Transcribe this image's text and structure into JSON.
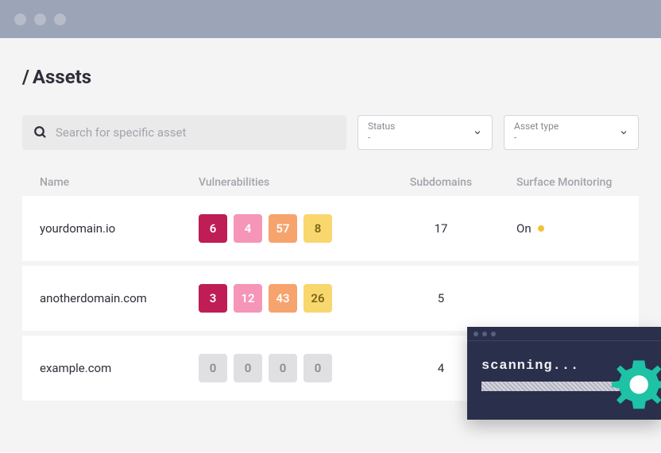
{
  "page": {
    "title_slash": "/",
    "title_text": "Assets"
  },
  "search": {
    "placeholder": "Search for specific asset"
  },
  "filters": {
    "status": {
      "label": "Status",
      "value": "-"
    },
    "asset_type": {
      "label": "Asset type",
      "value": "-"
    }
  },
  "columns": {
    "name": "Name",
    "vulnerabilities": "Vulnerabilities",
    "subdomains": "Subdomains",
    "surface": "Surface Monitoring"
  },
  "rows": [
    {
      "name": "yourdomain.io",
      "vuln": {
        "crit": "6",
        "high": "4",
        "med": "57",
        "low": "8"
      },
      "subdomains": "17",
      "surface": "On",
      "surface_status_color": "#f1c338"
    },
    {
      "name": "anotherdomain.com",
      "vuln": {
        "crit": "3",
        "high": "12",
        "med": "43",
        "low": "26"
      },
      "subdomains": "5",
      "surface": "",
      "surface_status_color": ""
    },
    {
      "name": "example.com",
      "vuln": {
        "crit": "0",
        "high": "0",
        "med": "0",
        "low": "0"
      },
      "subdomains": "4",
      "surface": "",
      "surface_status_color": ""
    }
  ],
  "scanner": {
    "text": "scanning..."
  },
  "colors": {
    "crit": "#be1d55",
    "high": "#f595b7",
    "med": "#f7a36d",
    "low": "#f9d76f",
    "zero": "#e0e0e3",
    "accent_gear": "#1ec2a4"
  }
}
